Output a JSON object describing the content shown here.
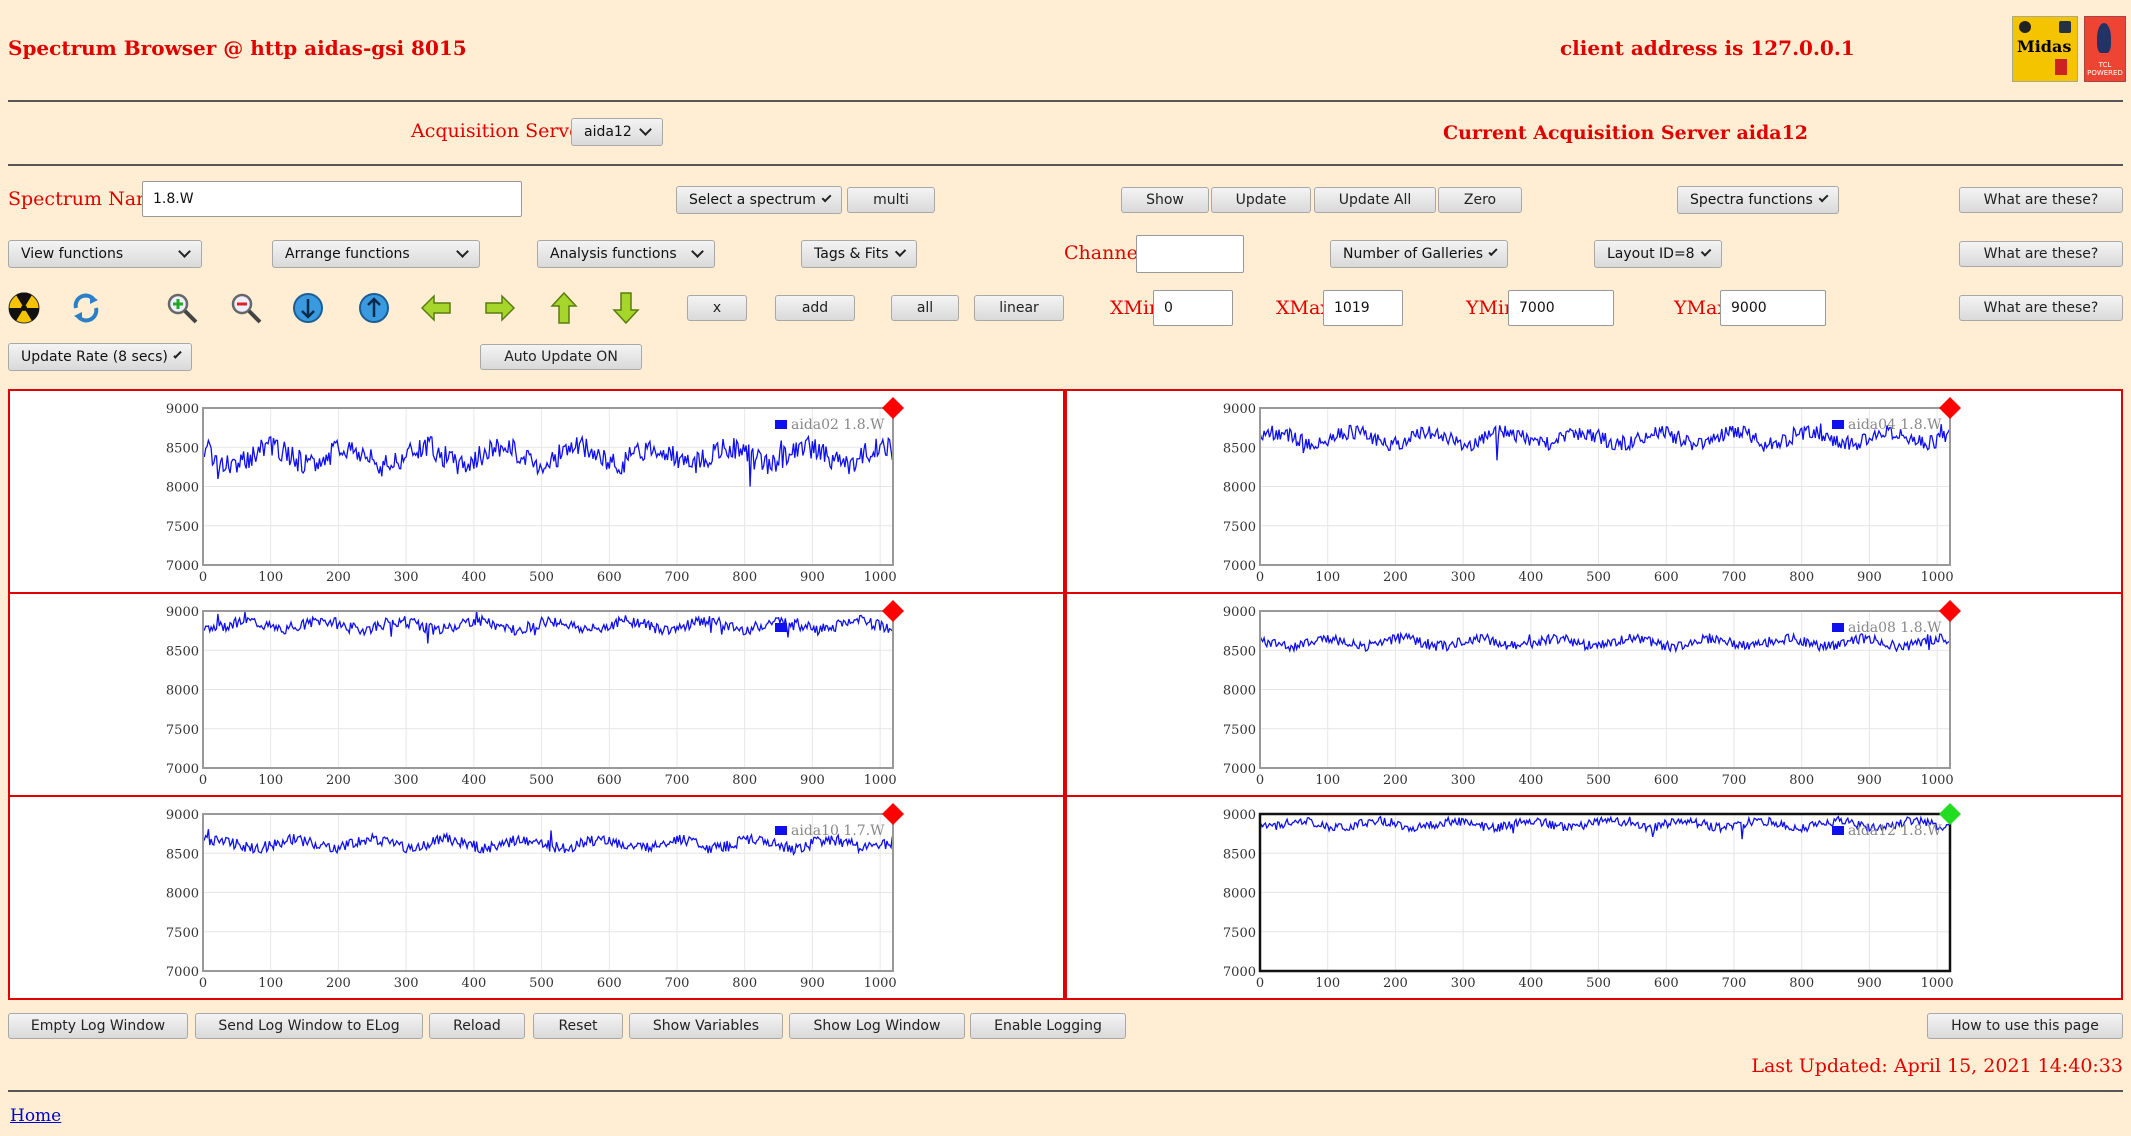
{
  "header": {
    "title": "Spectrum Browser @ http aidas-gsi 8015",
    "client_address": "client address is 127.0.0.1",
    "logo_midas_text": "Midas",
    "logo_tcl_text": "TCL POWERED"
  },
  "servers": {
    "label": "Acquisition Servers",
    "selected": "aida12",
    "current": "Current Acquisition Server aida12"
  },
  "row1": {
    "spectrum_name_label": "Spectrum Name:",
    "spectrum_name_value": "1.8.W",
    "select_spectrum": "Select a spectrum",
    "multi": "multi",
    "show": "Show",
    "update": "Update",
    "update_all": "Update All",
    "zero": "Zero",
    "spectra_functions": "Spectra functions",
    "what": "What are these?"
  },
  "row2": {
    "view_functions": "View functions",
    "arrange_functions": "Arrange functions",
    "analysis_functions": "Analysis functions",
    "tags_fits": "Tags & Fits",
    "channel_label": "Channel:",
    "channel_value": "",
    "galleries": "Number of Galleries",
    "layout": "Layout ID=8",
    "what": "What are these?"
  },
  "row3": {
    "x": "x",
    "add": "add",
    "all": "all",
    "linear": "linear",
    "xmin_label": "XMin",
    "xmin_value": "0",
    "xmax_label": "XMax",
    "xmax_value": "1019",
    "ymin_label": "YMin",
    "ymin_value": "7000",
    "ymax_label": "YMax",
    "ymax_value": "9000",
    "what": "What are these?"
  },
  "row4": {
    "update_rate": "Update Rate (8 secs)",
    "auto_update": "Auto Update ON"
  },
  "icons": [
    "radiation-icon",
    "refresh-icon",
    "zoom-in-icon",
    "zoom-out-icon",
    "expand-y-icon",
    "shrink-y-icon",
    "arrow-left-icon",
    "arrow-right-icon",
    "arrow-up-icon",
    "arrow-down-icon"
  ],
  "colors": {
    "accent_red": "#e00000",
    "series_blue": "#1010ee",
    "status_red": "#ff0000",
    "status_green": "#22dd22",
    "background": "#ffeed3"
  },
  "chart_data": [
    {
      "type": "line",
      "series": [
        {
          "name": "aida02 1.8.W",
          "values_note": "noisy"
        }
      ],
      "xlim": [
        0,
        1019
      ],
      "ylim": [
        7000,
        9000
      ],
      "x_ticks": [
        0,
        100,
        200,
        300,
        400,
        500,
        600,
        700,
        800,
        900,
        1000
      ],
      "y_ticks": [
        7000,
        7500,
        8000,
        8500,
        9000
      ],
      "status": "red",
      "grid": true,
      "legend": "top-right",
      "baseline": 8400,
      "amp": 180,
      "seed": 2
    },
    {
      "type": "line",
      "series": [
        {
          "name": "aida04 1.8.W"
        }
      ],
      "xlim": [
        0,
        1019
      ],
      "ylim": [
        7000,
        9000
      ],
      "x_ticks": [
        0,
        100,
        200,
        300,
        400,
        500,
        600,
        700,
        800,
        900,
        1000
      ],
      "y_ticks": [
        7000,
        7500,
        8000,
        8500,
        9000
      ],
      "status": "red",
      "grid": true,
      "legend": "top-right",
      "baseline": 8620,
      "amp": 120,
      "seed": 4
    },
    {
      "type": "line",
      "series": [
        {
          "name": ""
        }
      ],
      "xlim": [
        0,
        1019
      ],
      "ylim": [
        7000,
        9000
      ],
      "x_ticks": [
        0,
        100,
        200,
        300,
        400,
        500,
        600,
        700,
        800,
        900,
        1000
      ],
      "y_ticks": [
        7000,
        7500,
        8000,
        8500,
        9000
      ],
      "status": "red",
      "grid": true,
      "legend": "top-right",
      "baseline": 8820,
      "amp": 90,
      "seed": 6
    },
    {
      "type": "line",
      "series": [
        {
          "name": "aida08 1.8.W"
        }
      ],
      "xlim": [
        0,
        1019
      ],
      "ylim": [
        7000,
        9000
      ],
      "x_ticks": [
        0,
        100,
        200,
        300,
        400,
        500,
        600,
        700,
        800,
        900,
        1000
      ],
      "y_ticks": [
        7000,
        7500,
        8000,
        8500,
        9000
      ],
      "status": "red",
      "grid": true,
      "legend": "top-right",
      "baseline": 8600,
      "amp": 80,
      "seed": 8
    },
    {
      "type": "line",
      "series": [
        {
          "name": "aida10 1.7.W"
        }
      ],
      "xlim": [
        0,
        1019
      ],
      "ylim": [
        7000,
        9000
      ],
      "x_ticks": [
        0,
        100,
        200,
        300,
        400,
        500,
        600,
        700,
        800,
        900,
        1000
      ],
      "y_ticks": [
        7000,
        7500,
        8000,
        8500,
        9000
      ],
      "status": "red",
      "grid": true,
      "legend": "top-right",
      "baseline": 8620,
      "amp": 90,
      "seed": 10
    },
    {
      "type": "line",
      "series": [
        {
          "name": "aida12 1.8.W"
        }
      ],
      "xlim": [
        0,
        1019
      ],
      "ylim": [
        7000,
        9000
      ],
      "x_ticks": [
        0,
        100,
        200,
        300,
        400,
        500,
        600,
        700,
        800,
        900,
        1000
      ],
      "y_ticks": [
        7000,
        7500,
        8000,
        8500,
        9000
      ],
      "status": "green",
      "grid": true,
      "legend": "top-right",
      "baseline": 8870,
      "amp": 70,
      "seed": 12,
      "selected": true
    }
  ],
  "bottom": {
    "empty_log": "Empty Log Window",
    "send_log": "Send Log Window to ELog",
    "reload": "Reload",
    "reset": "Reset",
    "show_variables": "Show Variables",
    "show_log": "Show Log Window",
    "enable_logging": "Enable Logging",
    "how_to": "How to use this page",
    "last_updated": "Last Updated: April 15, 2021 14:40:33",
    "home": "Home"
  }
}
